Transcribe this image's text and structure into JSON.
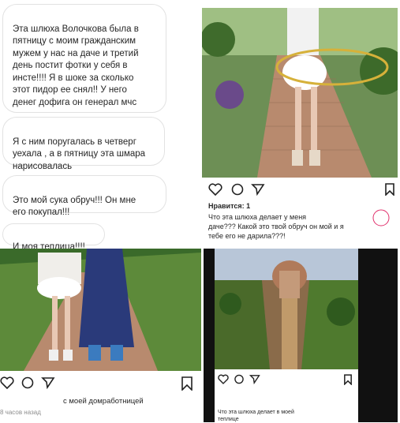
{
  "chat": {
    "messages": [
      {
        "text": "Эта шлюха Волочкова была в\nпятницу с моим гражданским\nмужем у нас на даче и третий\nдень постит фотки у себя в\nинсте!!!! Я в шоке за сколько\nэтот пидор ее снял!! У него\nденег дофига он генерал мчс"
      },
      {
        "text": "Я с ним поругалась в четверг\nуехала , а в пятницу эта шмара\nнарисовалась"
      },
      {
        "text": "Это мой сука обруч!!! Он мне\nего покупал!!!"
      },
      {
        "text": "И моя теплица!!!!"
      }
    ]
  },
  "post1": {
    "likes": "Нравится: 1",
    "caption": "Что эта шлюха делает у меня\nдаче??? Какой это твой обруч он мой и я\nтебе его не дарила???!"
  },
  "post2": {
    "caption": "с моей домработницей",
    "time": "8 часов назад"
  },
  "post3": {
    "caption": "Что эта шлюха делает в моей\nтеплице"
  },
  "icons": [
    "heart-icon",
    "comment-icon",
    "share-icon",
    "bookmark-icon"
  ],
  "colors": {
    "path": "#b88a6e",
    "grass": "#5d8a3a",
    "dark": "#111111"
  }
}
